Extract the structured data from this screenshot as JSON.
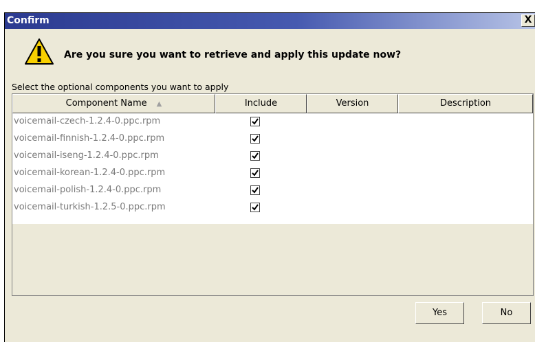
{
  "dialog": {
    "title": "Confirm",
    "close_label": "X",
    "question": "Are you sure you want to retrieve and apply this update now?",
    "subtitle": "Select the optional components you want to apply"
  },
  "table": {
    "columns": [
      "Component Name",
      "Include",
      "Version",
      "Description"
    ],
    "rows": [
      {
        "name": "voicemail-czech-1.2.4-0.ppc.rpm",
        "include": true
      },
      {
        "name": "voicemail-finnish-1.2.4-0.ppc.rpm",
        "include": true
      },
      {
        "name": "voicemail-iseng-1.2.4-0.ppc.rpm",
        "include": true
      },
      {
        "name": "voicemail-korean-1.2.4-0.ppc.rpm",
        "include": true
      },
      {
        "name": "voicemail-polish-1.2.4-0.ppc.rpm",
        "include": true
      },
      {
        "name": "voicemail-turkish-1.2.5-0.ppc.rpm",
        "include": true
      }
    ]
  },
  "buttons": {
    "yes": "Yes",
    "no": "No"
  }
}
